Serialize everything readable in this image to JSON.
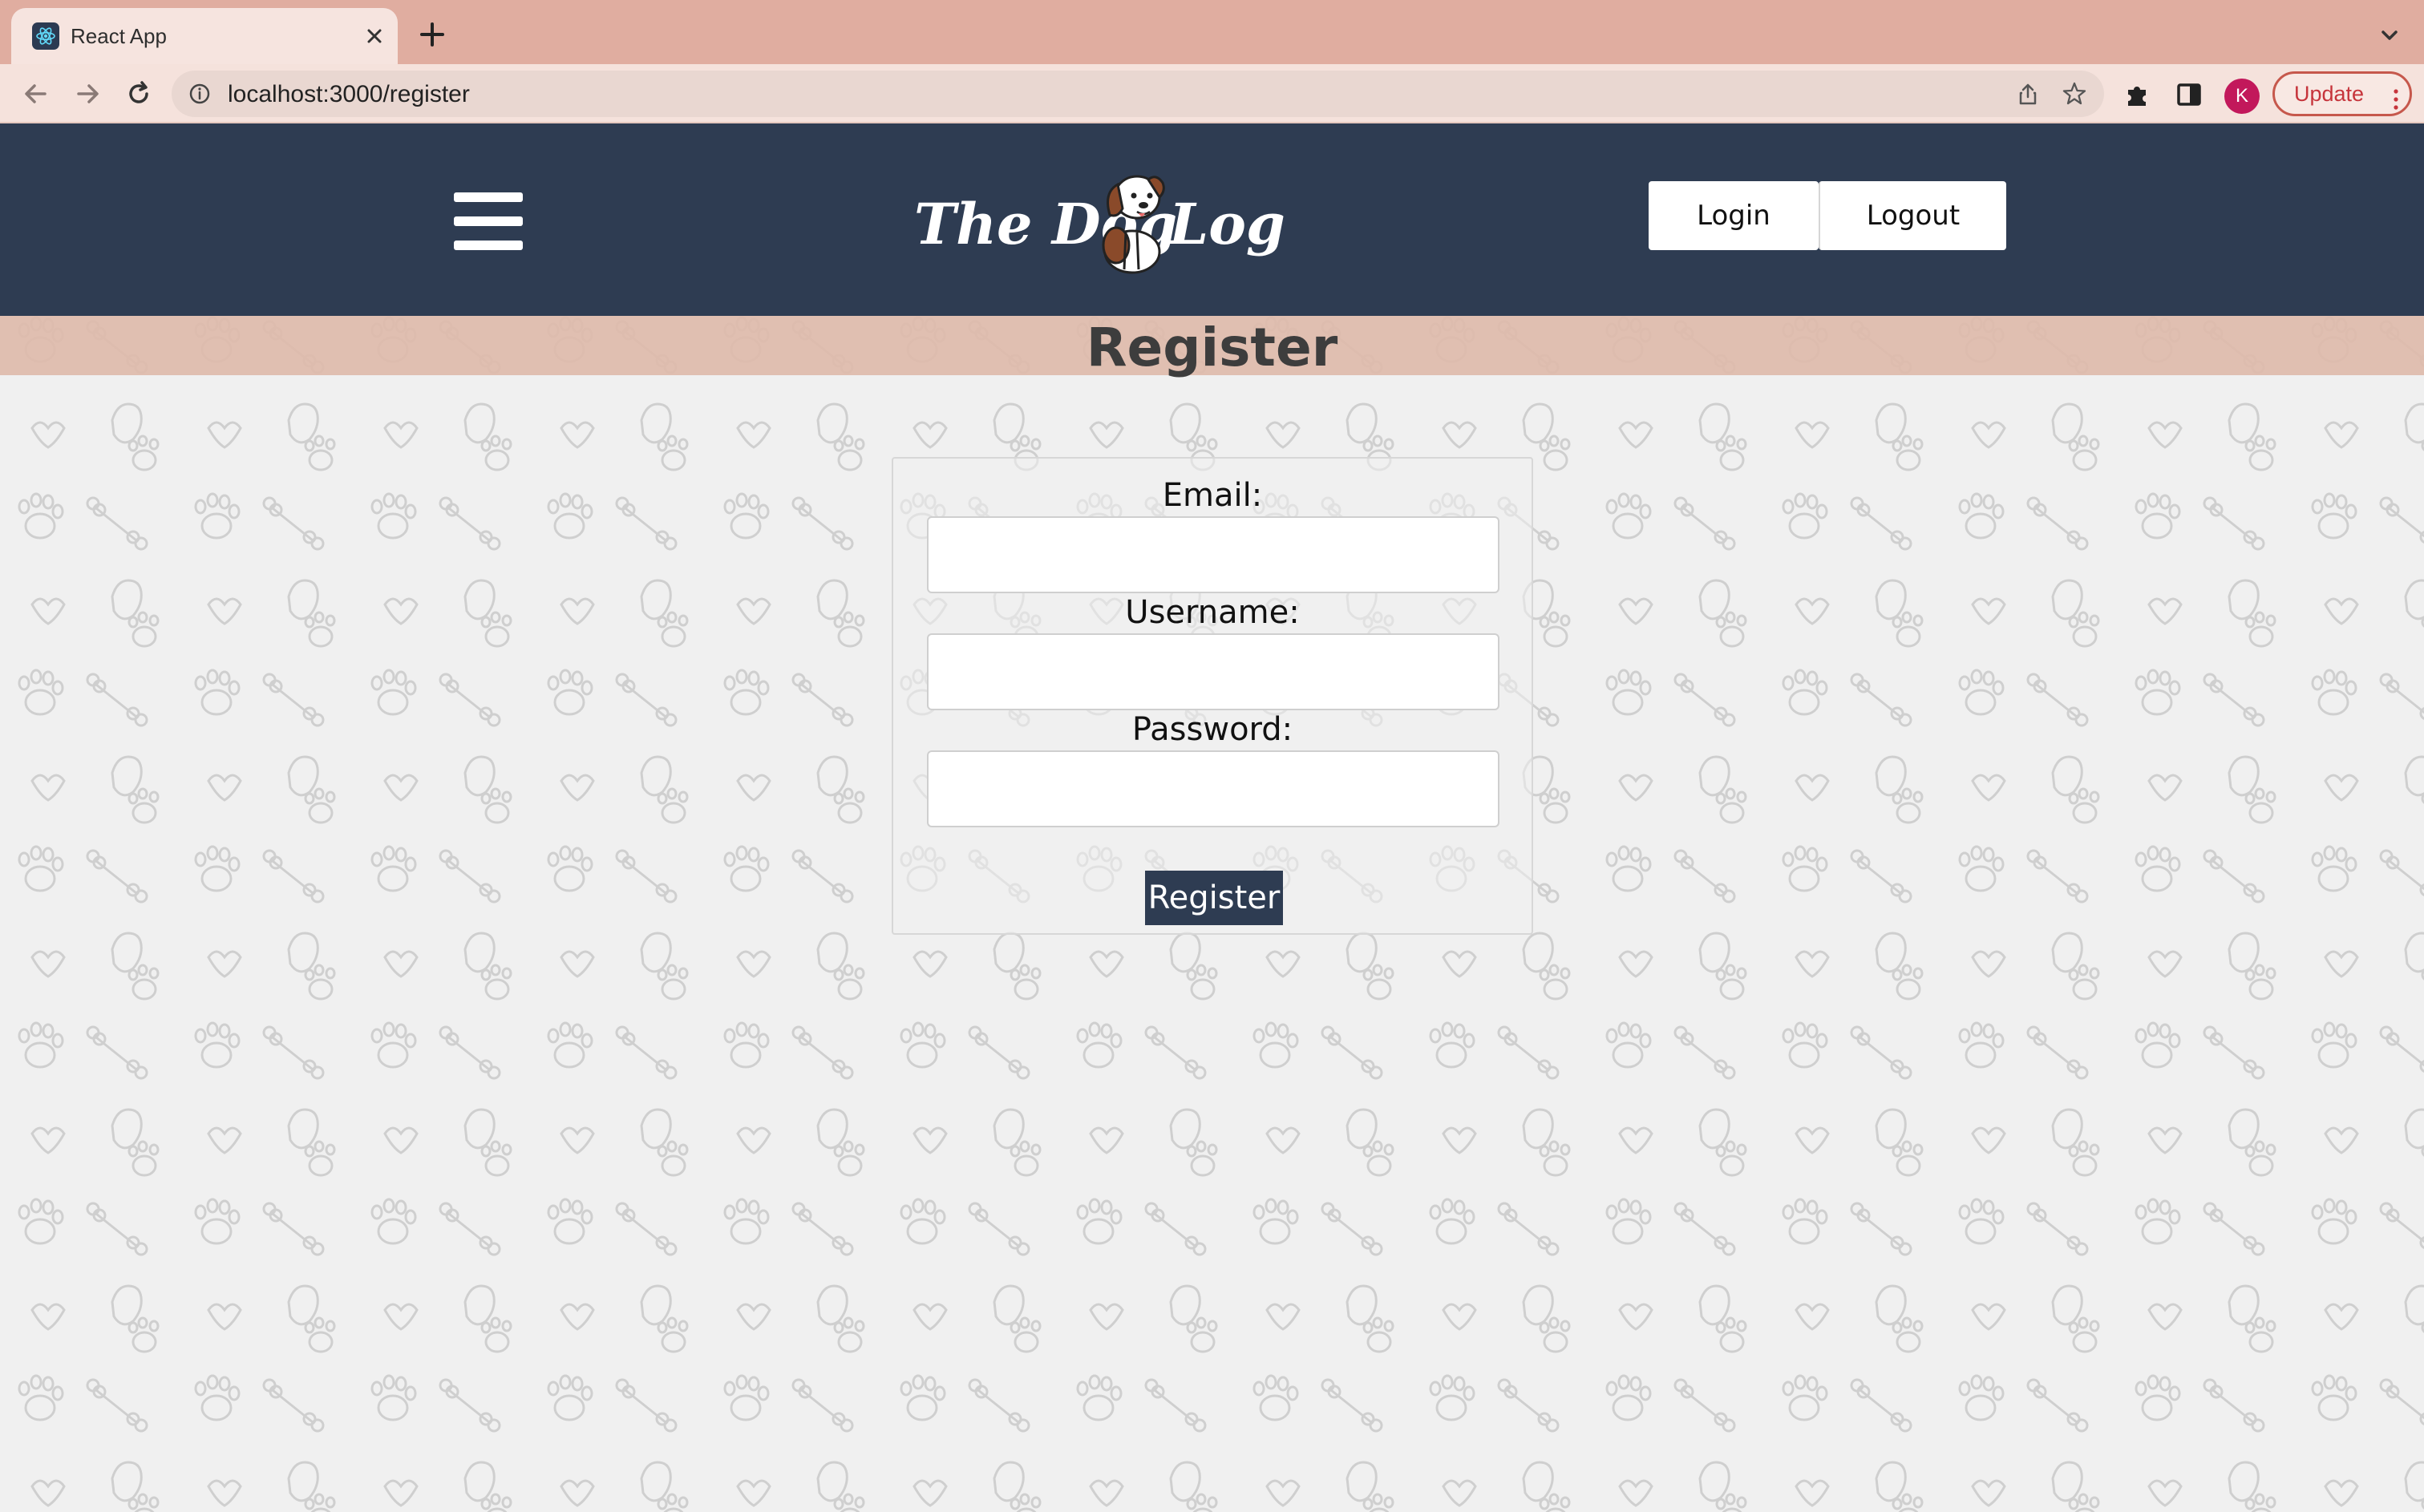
{
  "browser": {
    "tab_title": "React App",
    "url": "localhost:3000/register",
    "avatar_initial": "K",
    "update_label": "Update"
  },
  "header": {
    "logo_text_left": "The Dog",
    "logo_text_right": "Log",
    "login_label": "Login",
    "logout_label": "Logout",
    "bg_color": "#2e3c52"
  },
  "page": {
    "title": "Register"
  },
  "form": {
    "email_label": "Email:",
    "email_value": "",
    "username_label": "Username:",
    "username_value": "",
    "password_label": "Password:",
    "password_value": "",
    "submit_label": "Register"
  },
  "icons": {
    "tab_favicon": "react-icon",
    "menu": "hamburger-icon",
    "logo_mascot": "dog-icon"
  }
}
